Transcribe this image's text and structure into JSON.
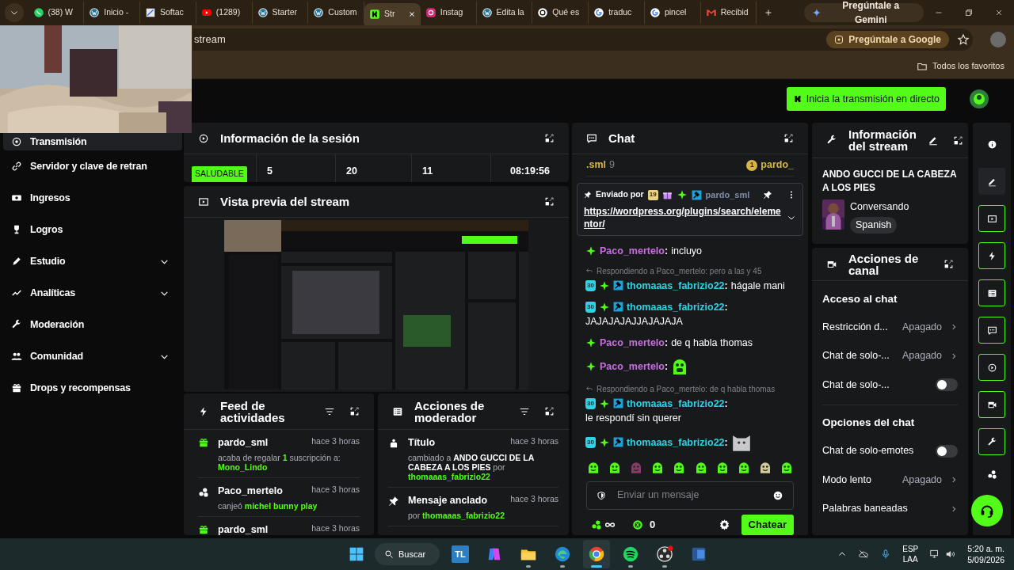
{
  "browser": {
    "tabs": [
      {
        "label": "(38) W",
        "kind": "whatsapp",
        "selected": false
      },
      {
        "label": "Inicio -",
        "kind": "wordpress",
        "selected": false
      },
      {
        "label": "Softac",
        "kind": "softac",
        "selected": false
      },
      {
        "label": "(1289)",
        "kind": "youtube",
        "selected": false
      },
      {
        "label": "Starter",
        "kind": "wordpress",
        "selected": false
      },
      {
        "label": "Custom",
        "kind": "wordpress",
        "selected": false
      },
      {
        "label": "Str",
        "kind": "kick",
        "selected": true
      },
      {
        "label": "Instag",
        "kind": "instagram",
        "selected": false
      },
      {
        "label": "Edita la",
        "kind": "wordpress",
        "selected": false
      },
      {
        "label": "Qué es",
        "kind": "chatgpt",
        "selected": false
      },
      {
        "label": "traduc",
        "kind": "google",
        "selected": false
      },
      {
        "label": "pincel",
        "kind": "google",
        "selected": false
      },
      {
        "label": "Recibid",
        "kind": "gmail",
        "selected": false
      }
    ],
    "gemini_button": "Pregúntale a Gemini",
    "address": "stream",
    "google_chip": "Pregúntale a Google",
    "bookmarks_folder": "Todos los favoritos"
  },
  "header": {
    "go_live_button": "Inicia la transmisión en directo"
  },
  "sidebar": {
    "items": [
      {
        "label": "Transmisión",
        "kind": "broadcast",
        "selected": true,
        "expandable": false
      },
      {
        "label": "Servidor y clave de retran",
        "kind": "link",
        "selected": false,
        "expandable": false
      },
      {
        "label": "Ingresos",
        "kind": "money",
        "selected": false,
        "expandable": false
      },
      {
        "label": "Logros",
        "kind": "trophy",
        "selected": false,
        "expandable": false
      },
      {
        "label": "Estudio",
        "kind": "pen",
        "selected": false,
        "expandable": true
      },
      {
        "label": "Analíticas",
        "kind": "chart",
        "selected": false,
        "expandable": true
      },
      {
        "label": "Moderación",
        "kind": "wrench",
        "selected": false,
        "expandable": false
      },
      {
        "label": "Comunidad",
        "kind": "people",
        "selected": false,
        "expandable": true
      },
      {
        "label": "Drops y recompensas",
        "kind": "gift",
        "selected": false,
        "expandable": false
      }
    ]
  },
  "session": {
    "title": "Información de la sesión",
    "health": "SALUDABLE",
    "stats": [
      "5",
      "20",
      "11",
      "08:19:56"
    ]
  },
  "preview": {
    "title": "Vista previa del stream"
  },
  "feed": {
    "title": "Feed de actividades",
    "items": [
      {
        "kind": "gift",
        "user": "pardo_sml",
        "time": "hace 3 horas",
        "detail": [
          {
            "kind": "plain",
            "text": "acaba de regalar "
          },
          {
            "kind": "accent",
            "text": "1"
          },
          {
            "kind": "plain",
            "text": " suscripción a: "
          },
          {
            "kind": "accent",
            "text": "Mono_Lindo"
          }
        ]
      },
      {
        "kind": "points",
        "user": "Paco_mertelo",
        "time": "hace 3 horas",
        "detail": [
          {
            "kind": "plain",
            "text": "canjeó "
          },
          {
            "kind": "accent",
            "text": "michel bunny play"
          }
        ]
      },
      {
        "kind": "gift",
        "user": "pardo_sml",
        "time": "hace 3 horas"
      }
    ]
  },
  "moderator": {
    "title": "Acciones de moderador",
    "items": [
      {
        "kind": "title",
        "label": "Título",
        "time": "hace 3 horas",
        "detail": [
          {
            "kind": "plain",
            "text": "cambiado a "
          },
          {
            "kind": "strong",
            "text": "ANDO GUCCI DE LA CABEZA A LOS PIES"
          },
          {
            "kind": "plain",
            "text": " por "
          },
          {
            "kind": "accent",
            "text": "thomaaas_fabrizio22"
          }
        ]
      },
      {
        "kind": "pin",
        "label": "Mensaje anclado",
        "time": "hace 3 horas",
        "detail": [
          {
            "kind": "plain",
            "text": "por "
          },
          {
            "kind": "accent",
            "text": "thomaaas_fabrizio22"
          }
        ]
      }
    ]
  },
  "chat": {
    "title": "Chat",
    "leaderboard": [
      {
        "user": ".sml",
        "count": "9"
      },
      {
        "rank": "1",
        "user": "pardo_"
      }
    ],
    "pinned": {
      "label": "Enviado por",
      "badges": [
        {
          "kind": "gift-sub",
          "label": "19"
        },
        {
          "kind": "gift"
        },
        {
          "kind": "sparkle"
        },
        {
          "kind": "mod"
        }
      ],
      "user": "pardo_sml",
      "link": "https://wordpress.org/plugins/search/elementor/"
    },
    "messages": [
      {
        "kind": "text",
        "badges": [
          {
            "kind": "sparkle"
          }
        ],
        "user": "Paco_mertelo",
        "color": "#c86ee0",
        "separator": ":",
        "text": "incluyo"
      },
      {
        "kind": "text",
        "reply": "Respondiendo a Paco_mertelo: pero a las y 45",
        "badges": [
          {
            "kind": "sub",
            "label": "30"
          },
          {
            "kind": "sparkle"
          },
          {
            "kind": "mod"
          }
        ],
        "user": "thomaaas_fabrizio22",
        "color": "#2ed3e6",
        "separator": ":",
        "text": "hágale mani"
      },
      {
        "kind": "text",
        "badges": [
          {
            "kind": "sub",
            "label": "30"
          },
          {
            "kind": "sparkle"
          },
          {
            "kind": "mod"
          }
        ],
        "user": "thomaaas_fabrizio22",
        "color": "#2ed3e6",
        "separator": ":",
        "text": "JAJAJAJAJJAJAJAJA"
      },
      {
        "kind": "text",
        "badges": [
          {
            "kind": "sparkle"
          }
        ],
        "user": "Paco_mertelo",
        "color": "#c86ee0",
        "separator": ":",
        "text": "de q habla thomas"
      },
      {
        "kind": "cry-emote",
        "badges": [
          {
            "kind": "sparkle"
          }
        ],
        "user": "Paco_mertelo",
        "color": "#c86ee0",
        "separator": ":"
      },
      {
        "kind": "text",
        "reply": "Respondiendo a Paco_mertelo: de q habla thomas",
        "badges": [
          {
            "kind": "sub",
            "label": "30"
          },
          {
            "kind": "sparkle"
          },
          {
            "kind": "mod"
          }
        ],
        "user": "thomaaas_fabrizio22",
        "color": "#2ed3e6",
        "separator": ":",
        "text": "le respondí sin querer"
      },
      {
        "kind": "cat-emote",
        "badges": [
          {
            "kind": "sub",
            "label": "30"
          },
          {
            "kind": "sparkle"
          },
          {
            "kind": "mod"
          }
        ],
        "user": "thomaaas_fabrizio22",
        "color": "#2ed3e6",
        "separator": ":"
      }
    ],
    "placeholder": "Enviar un mensaje",
    "points": "0",
    "send_button": "Chatear"
  },
  "stream_info": {
    "title": "Información del stream",
    "stream_title": "ANDO GUCCI DE LA CABEZA A LOS PIES",
    "category": "Conversando",
    "tags": [
      "Spanish"
    ]
  },
  "channel_actions": {
    "title": "Acciones de canal",
    "sections": [
      {
        "heading": "Acceso al chat",
        "rows": [
          {
            "kind": "select",
            "label": "Restricción d...",
            "value": "Apagado"
          },
          {
            "kind": "select",
            "label": "Chat de solo-...",
            "value": "Apagado"
          },
          {
            "kind": "toggle",
            "label": "Chat de solo-...",
            "on": false
          }
        ]
      },
      {
        "heading": "Opciones del chat",
        "rows": [
          {
            "kind": "toggle",
            "label": "Chat de solo-emotes",
            "on": false
          },
          {
            "kind": "select",
            "label": "Modo lento",
            "value": "Apagado"
          },
          {
            "kind": "link",
            "label": "Palabras baneadas"
          }
        ]
      }
    ]
  },
  "rail": [
    {
      "kind": "info",
      "docked": false,
      "selected": false
    },
    {
      "kind": "edit",
      "docked": false,
      "selected": true
    },
    {
      "kind": "preview",
      "docked": true,
      "selected": false
    },
    {
      "kind": "bolt",
      "docked": true,
      "selected": false
    },
    {
      "kind": "list",
      "docked": true,
      "selected": false
    },
    {
      "kind": "chat",
      "docked": true,
      "selected": false
    },
    {
      "kind": "play",
      "docked": true,
      "selected": false
    },
    {
      "kind": "camera",
      "docked": true,
      "selected": false
    },
    {
      "kind": "wrench",
      "docked": true,
      "selected": false
    },
    {
      "kind": "community",
      "docked": false,
      "selected": false
    }
  ],
  "taskbar": {
    "search": "Buscar",
    "apps": [
      {
        "kind": "tl",
        "label": "TL",
        "open": false,
        "selected": false
      },
      {
        "kind": "copilot",
        "open": false,
        "selected": false
      },
      {
        "kind": "files",
        "open": true,
        "selected": false
      },
      {
        "kind": "edge",
        "open": true,
        "selected": false
      },
      {
        "kind": "chrome",
        "open": true,
        "selected": true
      },
      {
        "kind": "spotify",
        "open": true,
        "selected": false
      },
      {
        "kind": "obs",
        "open": true,
        "selected": false
      },
      {
        "kind": "word",
        "open": false,
        "selected": false
      }
    ],
    "language": [
      "ESP",
      "LAA"
    ],
    "time": "5:20 a. m.",
    "date": "5/09/2026"
  }
}
